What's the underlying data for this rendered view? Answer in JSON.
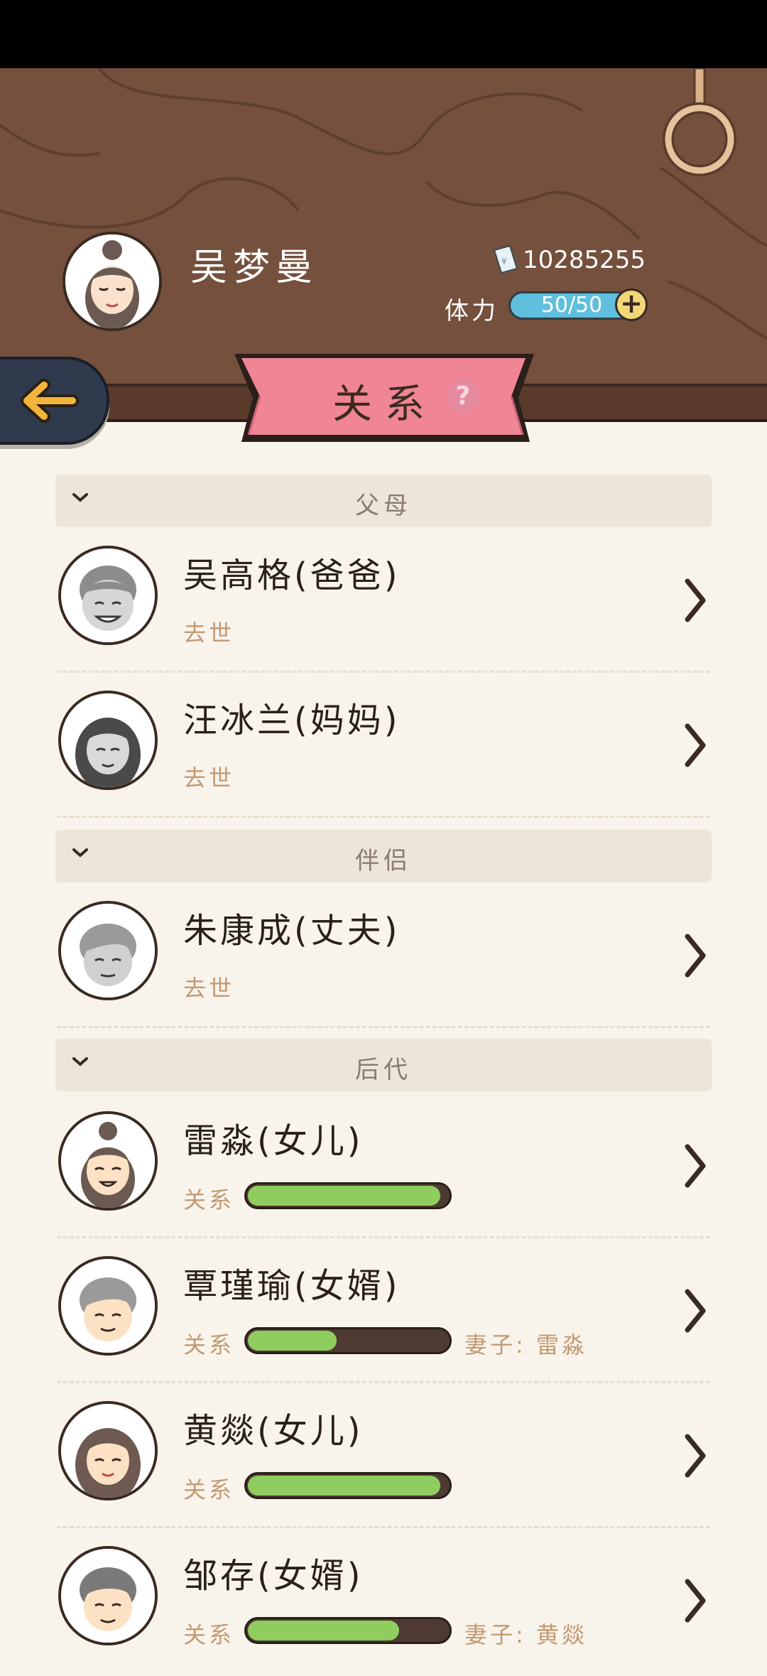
{
  "player": {
    "name": "吴梦曼",
    "coins": "10285255",
    "stamina_label": "体力",
    "stamina": "50/50"
  },
  "banner": {
    "title": "关系"
  },
  "sections": [
    {
      "title": "父母",
      "members": [
        {
          "name": "吴高格(爸爸)",
          "status": "去世"
        },
        {
          "name": "汪冰兰(妈妈)",
          "status": "去世"
        }
      ]
    },
    {
      "title": "伴侣",
      "members": [
        {
          "name": "朱康成(丈夫)",
          "status": "去世"
        }
      ]
    },
    {
      "title": "后代",
      "members": [
        {
          "name": "雷淼(女儿)",
          "relation_label": "关系",
          "relation": 0.96
        },
        {
          "name": "覃瑾瑜(女婿)",
          "relation_label": "关系",
          "relation": 0.45,
          "spouse": "妻子: 雷淼"
        },
        {
          "name": "黄燚(女儿)",
          "relation_label": "关系",
          "relation": 0.96
        },
        {
          "name": "邹存(女婿)",
          "relation_label": "关系",
          "relation": 0.76,
          "spouse": "妻子: 黄燚"
        }
      ]
    }
  ],
  "colors": {
    "wood": "#74503d",
    "banner": "#ef8595",
    "relation_fill": "#8fce5e",
    "stamina": "#5fbfdc"
  }
}
